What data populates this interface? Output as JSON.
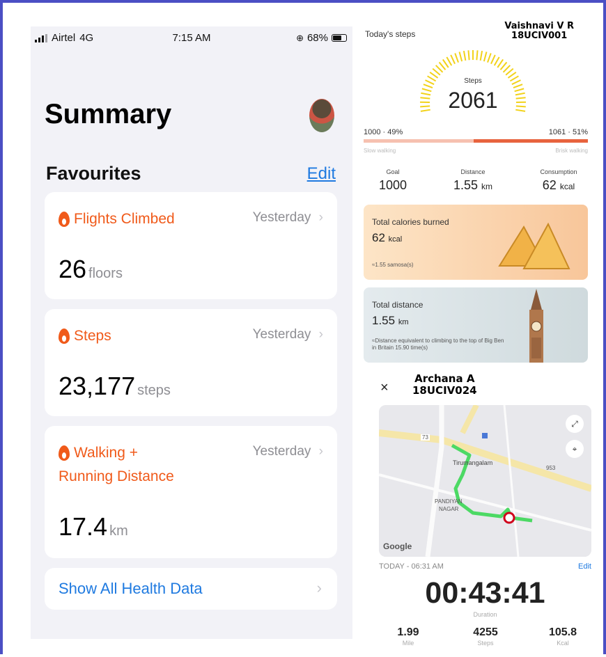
{
  "status": {
    "carrier": "Airtel",
    "network": "4G",
    "time": "7:15 AM",
    "battery": "68%"
  },
  "summary": {
    "title": "Summary",
    "favourites_label": "Favourites",
    "edit_label": "Edit",
    "cards": [
      {
        "label_line1": "Flights Climbed",
        "label_line2": "",
        "when": "Yesterday",
        "value": "26",
        "unit": "floors"
      },
      {
        "label_line1": "Steps",
        "label_line2": "",
        "when": "Yesterday",
        "value": "23,177",
        "unit": "steps"
      },
      {
        "label_line1": "Walking +",
        "label_line2": "Running Distance",
        "when": "Yesterday",
        "value": "17.4",
        "unit": "km"
      }
    ],
    "show_all": "Show All Health Data",
    "chevron": "›"
  },
  "steps_app": {
    "todays_steps": "Today's steps",
    "name": "Vaishnavi V R",
    "roll": "18UCIV001",
    "steps_label": "Steps",
    "steps_value": "2061",
    "progress_left": "1000 · 49%",
    "progress_right": "1061 · 51%",
    "progress_split": 0.49,
    "slow_label": "Slow walking",
    "brisk_label": "Brisk walking",
    "goal_label": "Goal",
    "goal_value": "1000",
    "distance_label": "Distance",
    "distance_value": "1.55",
    "distance_unit": "km",
    "consumption_label": "Consumption",
    "consumption_value": "62",
    "consumption_unit": "kcal",
    "calories_title": "Total calories burned",
    "calories_value": "62",
    "calories_unit": "kcal",
    "calories_note": "≈1.55 samosa(s)",
    "totaldist_title": "Total distance",
    "totaldist_value": "1.55",
    "totaldist_unit": "km",
    "totaldist_note": "≈Distance equivalent to climbing to the top of Big Ben in Britain 15.90 time(s)"
  },
  "run_app": {
    "close": "×",
    "name": "Archana A",
    "roll": "18UCIV024",
    "map_labels": {
      "road": "73",
      "area1": "Tirumangalam",
      "area2": "PANDIYAN",
      "area3": "NAGAR",
      "road2": "953",
      "brand": "Google"
    },
    "today": "TODAY - 06:31 AM",
    "edit": "Edit",
    "duration": "00:43:41",
    "duration_label": "Duration",
    "miles_value": "1.99",
    "miles_label": "Mile",
    "steps_value": "4255",
    "steps_label": "Steps",
    "kcal_value": "105.8",
    "kcal_label": "Kcal"
  },
  "colors": {
    "accent": "#f05a1a",
    "link": "#1f7ae0",
    "route": "#4cd964",
    "border": "#4b4fc4"
  }
}
